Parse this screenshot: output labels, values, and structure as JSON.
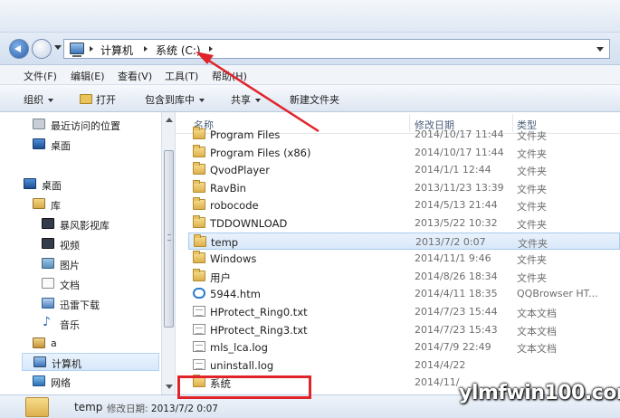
{
  "address_bar": {
    "crumbs": [
      "计算机",
      "系统 (C:)"
    ]
  },
  "menu": [
    "文件(F)",
    "编辑(E)",
    "查看(V)",
    "工具(T)",
    "帮助(H)"
  ],
  "toolbar": {
    "organize": "组织",
    "open": "打开",
    "include_in_library": "包含到库中",
    "share": "共享",
    "new_folder": "新建文件夹"
  },
  "nav_pane": {
    "items": [
      {
        "label": "最近访问的位置",
        "icon": "recent-places-icon"
      },
      {
        "label": "桌面",
        "icon": "desktop-icon"
      },
      {
        "label": "桌面",
        "icon": "desktop-icon"
      },
      {
        "label": "库",
        "icon": "library-icon"
      },
      {
        "label": "暴风影视库",
        "icon": "video-library-icon"
      },
      {
        "label": "视频",
        "icon": "video-icon"
      },
      {
        "label": "图片",
        "icon": "pictures-icon"
      },
      {
        "label": "文档",
        "icon": "documents-icon"
      },
      {
        "label": "迅雷下载",
        "icon": "thunder-download-icon"
      },
      {
        "label": "音乐",
        "icon": "music-icon"
      },
      {
        "label": "a",
        "icon": "user-folder-icon"
      },
      {
        "label": "计算机",
        "icon": "computer-icon"
      },
      {
        "label": "网络",
        "icon": "network-icon"
      }
    ]
  },
  "columns": {
    "name": "名称",
    "date": "修改日期",
    "type": "类型"
  },
  "files": [
    {
      "name": "Program Files",
      "date": "2014/10/17 11:44",
      "type": "文件夹",
      "icon": "folder-icon"
    },
    {
      "name": "Program Files (x86)",
      "date": "2014/10/17 11:44",
      "type": "文件夹",
      "icon": "folder-icon"
    },
    {
      "name": "QvodPlayer",
      "date": "2014/1/1 12:44",
      "type": "文件夹",
      "icon": "folder-icon"
    },
    {
      "name": "RavBin",
      "date": "2013/11/23 13:39",
      "type": "文件夹",
      "icon": "folder-icon"
    },
    {
      "name": "robocode",
      "date": "2014/5/13 21:44",
      "type": "文件夹",
      "icon": "folder-icon"
    },
    {
      "name": "TDDOWNLOAD",
      "date": "2013/5/22 10:32",
      "type": "文件夹",
      "icon": "folder-icon"
    },
    {
      "name": "temp",
      "date": "2013/7/2 0:07",
      "type": "文件夹",
      "icon": "folder-icon",
      "selected": true
    },
    {
      "name": "Windows",
      "date": "2014/11/1 9:46",
      "type": "文件夹",
      "icon": "folder-icon"
    },
    {
      "name": "用户",
      "date": "2014/8/26 18:34",
      "type": "文件夹",
      "icon": "folder-icon"
    },
    {
      "name": "5944.htm",
      "date": "2014/4/11 18:35",
      "type": "QQBrowser HT...",
      "icon": "htm-file-icon"
    },
    {
      "name": "HProtect_Ring0.txt",
      "date": "2014/7/23 15:44",
      "type": "文本文档",
      "icon": "text-file-icon"
    },
    {
      "name": "HProtect_Ring3.txt",
      "date": "2014/7/23 15:43",
      "type": "文本文档",
      "icon": "text-file-icon"
    },
    {
      "name": "mls_lca.log",
      "date": "2014/7/9 22:49",
      "type": "文本文档",
      "icon": "text-file-icon"
    },
    {
      "name": "uninstall.log",
      "date": "2014/4/22",
      "type": "",
      "icon": "text-file-icon"
    },
    {
      "name": "系统",
      "date": "2014/11/",
      "type": "",
      "icon": "folder-icon"
    }
  ],
  "status": {
    "name": "temp",
    "meta_label": "修改日期:",
    "meta_value": "2013/7/2 0:07"
  },
  "watermark": "ylmfwin100.com",
  "colors": {
    "annotation_red": "#e0242a",
    "selection": "#d9e8fa",
    "folder": "#e8c162"
  }
}
